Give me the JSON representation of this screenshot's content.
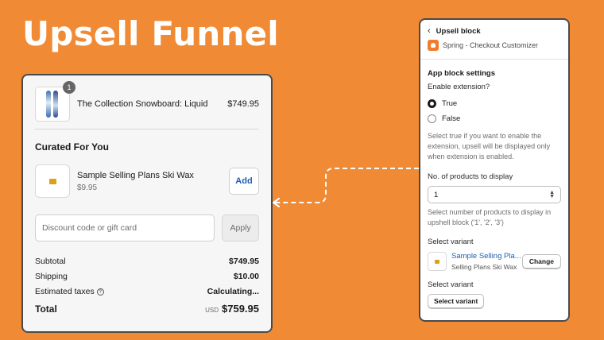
{
  "hero": {
    "title": "Upsell Funnel"
  },
  "colors": {
    "background": "#F18A34",
    "link": "#1f5fb0",
    "panel_border": "#4a4a4a"
  },
  "checkout": {
    "line_item": {
      "quantity": "1",
      "name": "The Collection Snowboard: Liquid",
      "price": "$749.95",
      "image_icon": "snowboard-icon"
    },
    "curated": {
      "title": "Curated For You",
      "product_name": "Sample Selling Plans Ski Wax",
      "product_price": "$9.95",
      "add_label": "Add",
      "image_icon": "ski-wax-icon"
    },
    "discount": {
      "placeholder": "Discount code or gift card",
      "value": "",
      "apply_label": "Apply"
    },
    "totals": {
      "subtotal_label": "Subtotal",
      "subtotal_value": "$749.95",
      "shipping_label": "Shipping",
      "shipping_value": "$10.00",
      "taxes_label": "Estimated taxes",
      "taxes_value": "Calculating...",
      "total_label": "Total",
      "currency": "USD",
      "total_value": "$759.95"
    }
  },
  "settings": {
    "back_title": "Upsell block",
    "app_name": "Spring - Checkout Customizer",
    "section_heading": "App block settings",
    "enable_label": "Enable extension?",
    "options": [
      {
        "label": "True",
        "checked": true
      },
      {
        "label": "False",
        "checked": false
      }
    ],
    "enable_help": "Select true if you want to enable the extension, upsell will be displayed only when extension is enabled.",
    "count_label": "No. of products to display",
    "count_value": "1",
    "count_help": "Select number of products to display in upshell block ('1', '2', '3')",
    "variant1": {
      "label": "Select variant",
      "name": "Sample Selling Pla...",
      "subtitle": "Selling Plans Ski Wax",
      "change_label": "Change"
    },
    "variant2": {
      "label": "Select variant",
      "button_label": "Select variant"
    }
  }
}
